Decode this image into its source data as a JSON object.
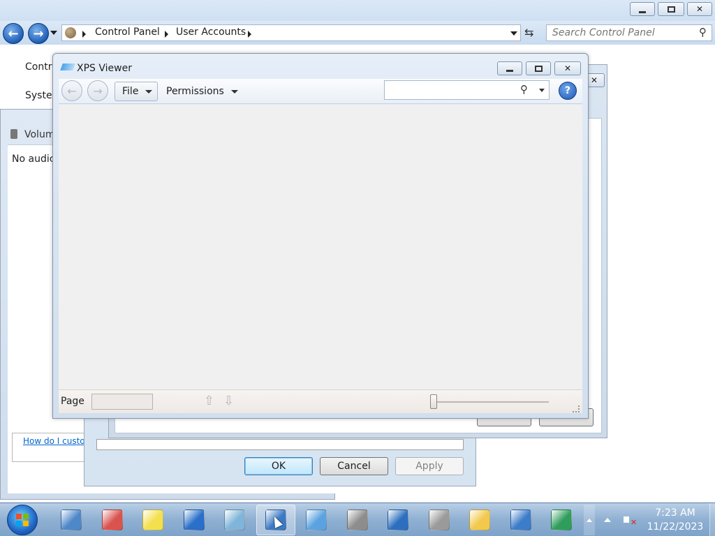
{
  "control_panel": {
    "breadcrumb": [
      "Control Panel",
      "User Accounts"
    ],
    "search_placeholder": "Search Control Panel",
    "sidebar_fragments": [
      "Contro",
      "Syster"
    ]
  },
  "volume_window": {
    "title": "Volum",
    "message": "No audic",
    "help_link": "How do I custo"
  },
  "dialog": {
    "ok": "OK",
    "cancel": "Cancel",
    "apply": "Apply"
  },
  "back_window": {
    "ok_fragment": "",
    "cancel_fragment": ""
  },
  "xps_viewer": {
    "title": "XPS Viewer",
    "menu_file": "File",
    "menu_permissions": "Permissions",
    "search_value": "",
    "page_label": "Page",
    "page_value": "",
    "zoom_level": 0.0
  },
  "clock": {
    "time": "7:23 AM",
    "date": "11/22/2023"
  },
  "taskbar_items": [
    {
      "icon": "calculator-icon",
      "color": "#4f88c8"
    },
    {
      "icon": "snipping-tool-icon",
      "color": "#d9534f"
    },
    {
      "icon": "sticky-notes-icon",
      "color": "#f4e04d"
    },
    {
      "icon": "remote-desktop-icon",
      "color": "#2a6fc9"
    },
    {
      "icon": "document-icon",
      "color": "#7fb5d8"
    },
    {
      "icon": "display-settings-icon",
      "color": "#3a79c4"
    },
    {
      "icon": "xps-viewer-icon",
      "color": "#5aa3e0"
    },
    {
      "icon": "server-icon",
      "color": "#8d8d8d"
    },
    {
      "icon": "projector-icon",
      "color": "#2c6fbf"
    },
    {
      "icon": "speaker-icon",
      "color": "#9a9a9a"
    },
    {
      "icon": "chat-icon",
      "color": "#f2c94c"
    },
    {
      "icon": "network-icon",
      "color": "#3d7cc9"
    },
    {
      "icon": "system-icon",
      "color": "#2f9e5c"
    }
  ]
}
